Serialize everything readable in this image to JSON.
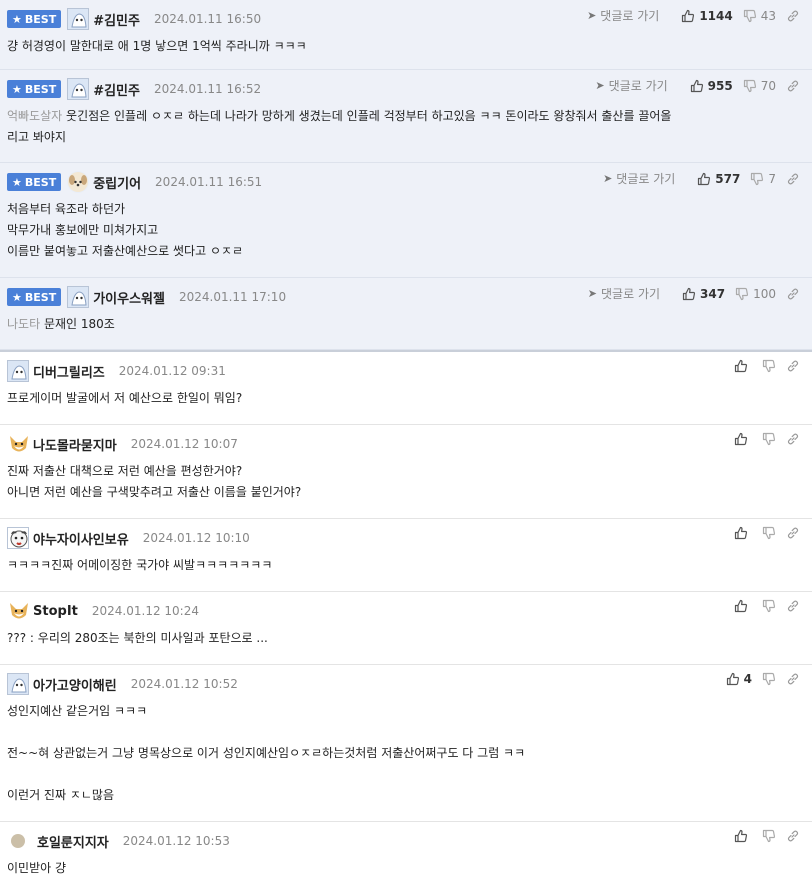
{
  "labels": {
    "best": "BEST",
    "reply": "댓글로 가기"
  },
  "best_comments": [
    {
      "nick": "#김민주",
      "date": "2024.01.11 16:50",
      "up": "1144",
      "down": "43",
      "prefix": "",
      "lines": [
        "걍 허경영이 말한대로 애 1명 낳으면 1억씩 주라니까 ㅋㅋㅋ"
      ]
    },
    {
      "nick": "#김민주",
      "date": "2024.01.11 16:52",
      "up": "955",
      "down": "70",
      "prefix": "억빠도살자",
      "lines": [
        "웃긴점은 인플레 ㅇㅈㄹ 하는데 나라가 망하게 생겼는데 인플레 걱정부터 하고있음 ㅋㅋ 돈이라도 왕창줘서 출산를 끌어올",
        "리고 봐야지"
      ]
    },
    {
      "nick": "중립기어",
      "date": "2024.01.11 16:51",
      "up": "577",
      "down": "7",
      "prefix": "",
      "lines": [
        "처음부터 육조라 하던가",
        "막무가내 홍보에만 미쳐가지고",
        "이름만 붙여놓고 저출산예산으로 썻다고 ㅇㅈㄹ"
      ]
    },
    {
      "nick": "가이우스워젤",
      "date": "2024.01.11 17:10",
      "up": "347",
      "down": "100",
      "prefix": "나도타",
      "lines": [
        "문재인 180조"
      ]
    }
  ],
  "comments": [
    {
      "nick": "디버그릴리즈",
      "date": "2024.01.12 09:31",
      "up": "",
      "lines": [
        "프로게이머 발굴에서 저 예산으로 한일이 뭐임?"
      ]
    },
    {
      "nick": "나도몰라묻지마",
      "date": "2024.01.12 10:07",
      "up": "",
      "lines": [
        "진짜 저출산 대책으로 저런 예산을 편성한거야?",
        "아니면 저런 예산을 구색맞추려고 저출산 이름을 붙인거야?"
      ]
    },
    {
      "nick": "야누자이사인보유",
      "date": "2024.01.12 10:10",
      "up": "",
      "lines": [
        "ㅋㅋㅋㅋ진짜 어메이징한 국가야 씨발ㅋㅋㅋㅋㅋㅋㅋ"
      ]
    },
    {
      "nick": "StopIt",
      "date": "2024.01.12 10:24",
      "up": "",
      "lines": [
        "??? : 우리의 280조는 북한의 미사일과 포탄으로 ..."
      ]
    },
    {
      "nick": "아가고양이해린",
      "date": "2024.01.12 10:52",
      "up": "4",
      "lines": [
        "성인지예산 같은거임 ㅋㅋㅋ",
        "",
        "전~~혀 상관없는거 그냥 명목상으로 이거 성인지예산임ㅇㅈㄹ하는것처럼 저출산어쩌구도 다 그럼 ㅋㅋ",
        "",
        "이런거 진짜 ㅈㄴ많음"
      ]
    },
    {
      "nick": "호일룬지지자",
      "date": "2024.01.12 10:53",
      "up": "",
      "lines": [
        "이민받아 걍"
      ]
    }
  ],
  "colors": {
    "best_bg": "#eef1f8",
    "badge": "#4a80d8"
  }
}
